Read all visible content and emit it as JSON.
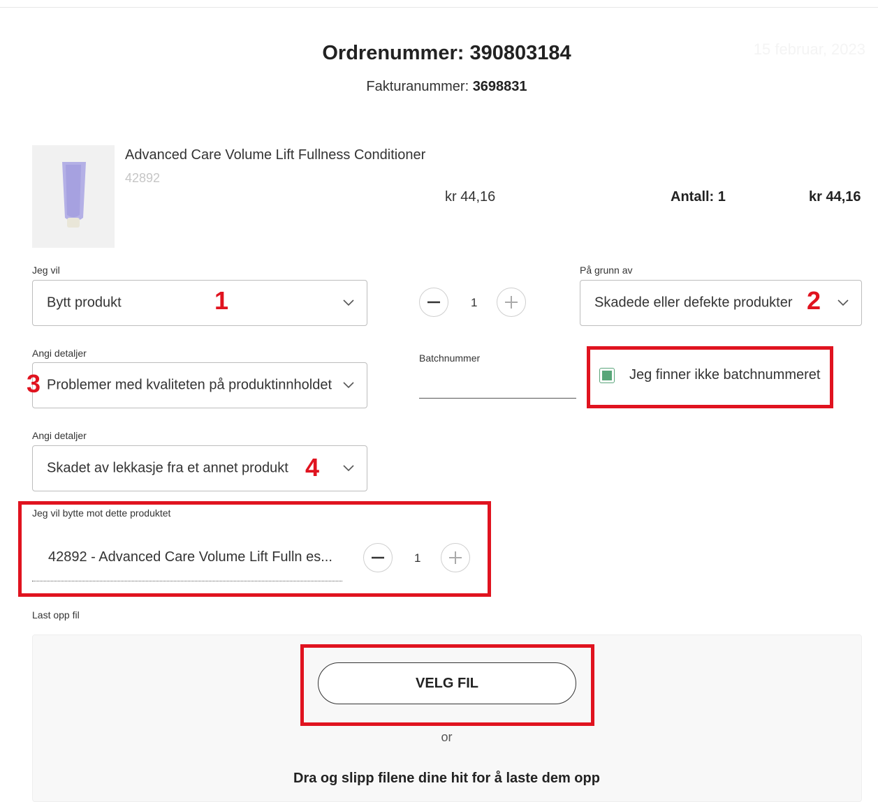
{
  "order": {
    "title": "Ordrenummer: 390803184",
    "date": "15 februar, 2023",
    "invoice_label": "Fakturanummer: ",
    "invoice_number": "3698831"
  },
  "product": {
    "name": "Advanced Care Volume Lift Fullness Conditioner",
    "sku": "42892",
    "price": "kr 44,16",
    "quantity_label": "Antall: 1",
    "total": "kr 44,16"
  },
  "form": {
    "jeg_vil": {
      "label": "Jeg vil",
      "value": "Bytt produkt",
      "marker": "1"
    },
    "quantity_stepper": {
      "value": "1"
    },
    "reason": {
      "label": "På grunn av",
      "value": "Skadede eller defekte produkter",
      "marker": "2"
    },
    "details_1": {
      "label": "Angi detaljer",
      "value": "Problemer med kvaliteten på produktinnholdet",
      "marker": "3"
    },
    "batch": {
      "label": "Batchnummer",
      "value": ""
    },
    "batch_checkbox": {
      "label": "Jeg finner ikke batchnummeret",
      "checked": true
    },
    "details_2": {
      "label": "Angi detaljer",
      "value": "Skadet av lekkasje fra et annet produkt",
      "marker": "4"
    },
    "exchange": {
      "label": "Jeg vil bytte mot dette produktet",
      "value": "42892 - Advanced Care Volume Lift Fulln es...",
      "quantity": "1"
    },
    "upload": {
      "label": "Last opp fil",
      "button": "VELG FIL",
      "or": "or",
      "drop_text": "Dra og slipp filene dine hit for å laste dem opp"
    }
  },
  "colors": {
    "highlight": "#e0131f",
    "checkbox_fill": "#58a679"
  }
}
